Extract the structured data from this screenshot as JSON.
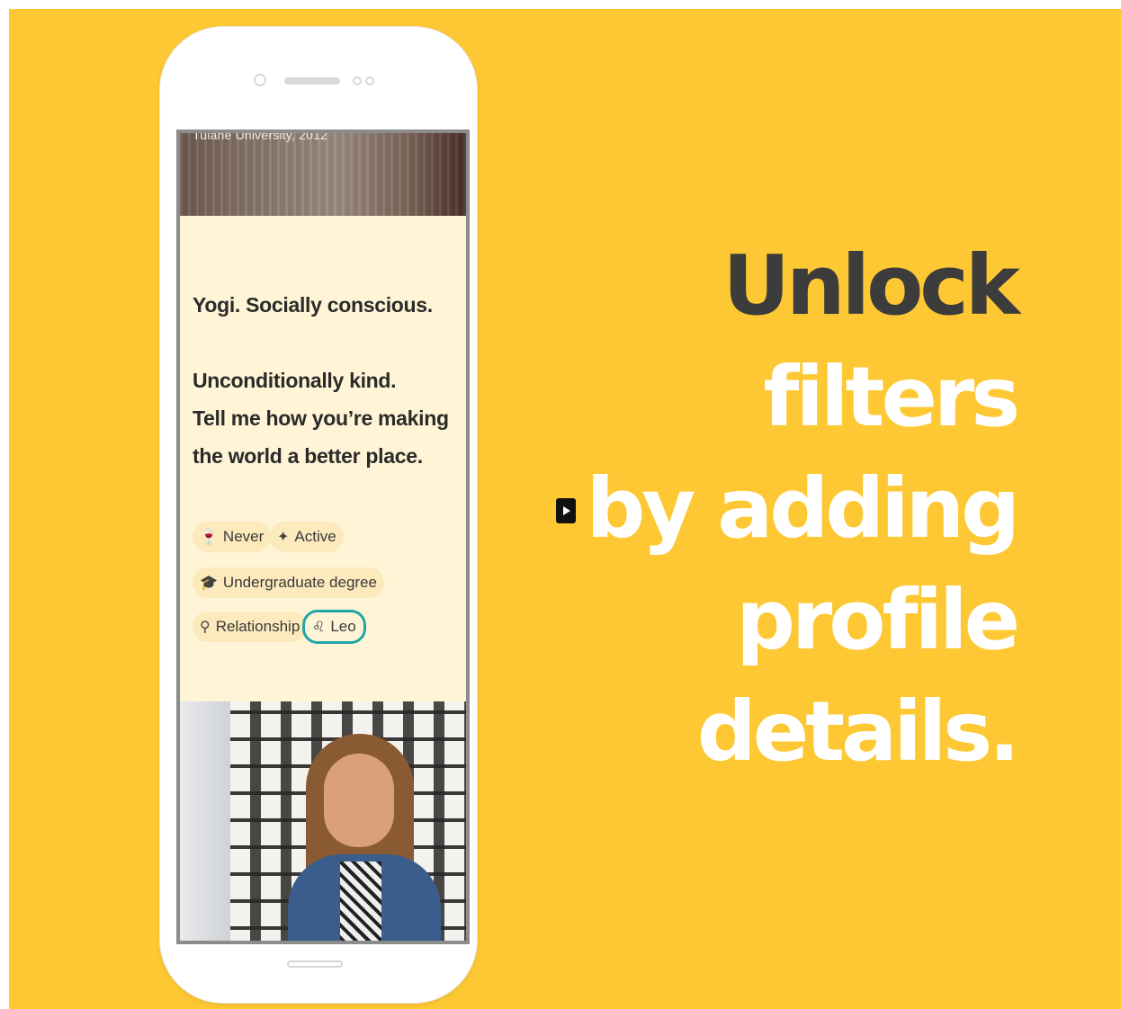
{
  "colors": {
    "background": "#FDC833",
    "profile_card": "#FFF4D6",
    "chip": "#FCE9BC",
    "highlight_ring": "#1FA5A8",
    "headline_dark": "#3C3C3C",
    "headline_light": "#FFFFFF"
  },
  "phone": {
    "top_photo_caption": "Tulane University, 2012",
    "bio_lines": [
      "Yogi. Socially conscious.",
      "Unconditionally kind.",
      "Tell me how you’re making",
      "the world a better place."
    ],
    "chips": [
      {
        "icon": "wine-glass-icon",
        "label": "Never"
      },
      {
        "icon": "dumbbell-icon",
        "label": "Active"
      },
      {
        "icon": "graduation-cap-icon",
        "label": "Undergraduate degree"
      },
      {
        "icon": "magnifier-icon",
        "label": "Relationship"
      },
      {
        "icon": "zodiac-leo-icon",
        "label": "Leo"
      }
    ]
  },
  "headline": {
    "line1": "Unlock",
    "line2": "filters",
    "line3": "by adding",
    "line4": "profile",
    "line5": "details."
  }
}
